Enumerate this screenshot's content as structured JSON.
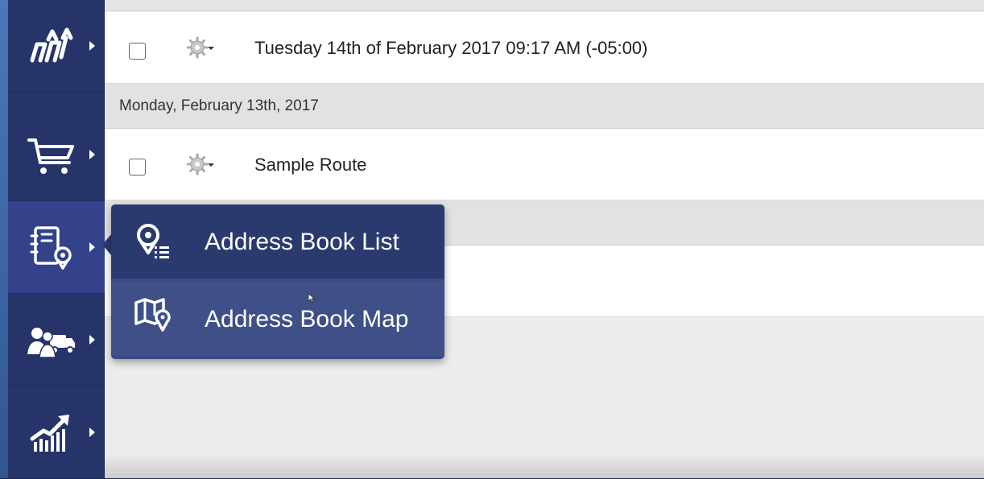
{
  "sidebar": {
    "items": [
      {
        "icon": "routes-icon"
      },
      {
        "icon": "cart-icon"
      },
      {
        "icon": "address-book-icon",
        "active": true
      },
      {
        "icon": "team-vehicle-icon"
      },
      {
        "icon": "analytics-icon"
      }
    ]
  },
  "list": {
    "row1": {
      "label": "Tuesday 14th of February 2017 09:17 AM (-05:00)"
    },
    "date_header": "Monday, February 13th, 2017",
    "row2": {
      "label": "Sample Route"
    }
  },
  "popup_menu": {
    "items": [
      {
        "label": "Address Book List",
        "icon": "address-list-icon"
      },
      {
        "label": "Address Book Map",
        "icon": "address-map-icon"
      }
    ]
  },
  "colors": {
    "sidebar_bg": "#27346a",
    "menu_bg": "#2b3a6e",
    "menu_hover": "#3f4f88"
  }
}
